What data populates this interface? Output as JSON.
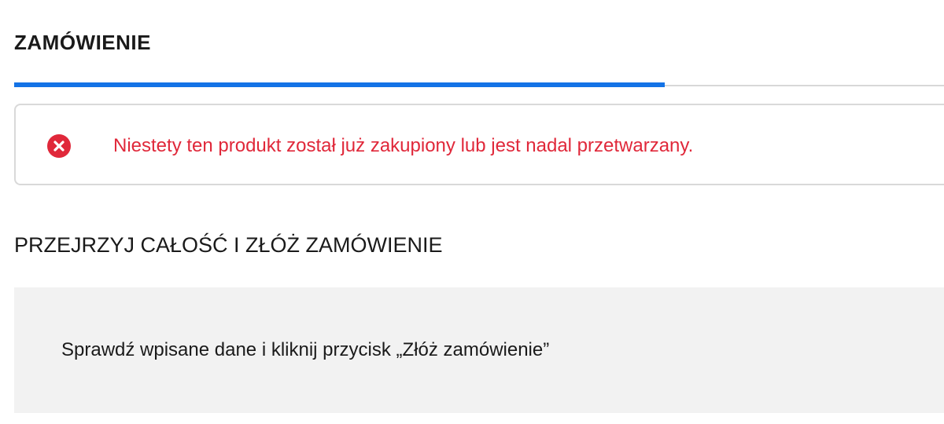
{
  "order": {
    "title": "ZAMÓWIENIE",
    "progress_fraction": 0.7,
    "accent_color": "#1473e6"
  },
  "alert": {
    "icon": "error-x-icon",
    "icon_color": "#e0283a",
    "message": "Niestety ten produkt został już zakupiony lub jest nadal przetwarzany."
  },
  "review": {
    "heading": "PRZEJRZYJ CAŁOŚĆ I ZŁÓŻ ZAMÓWIENIE",
    "instruction": "Sprawdź wpisane dane i kliknij przycisk „Złóż zamówienie”"
  }
}
